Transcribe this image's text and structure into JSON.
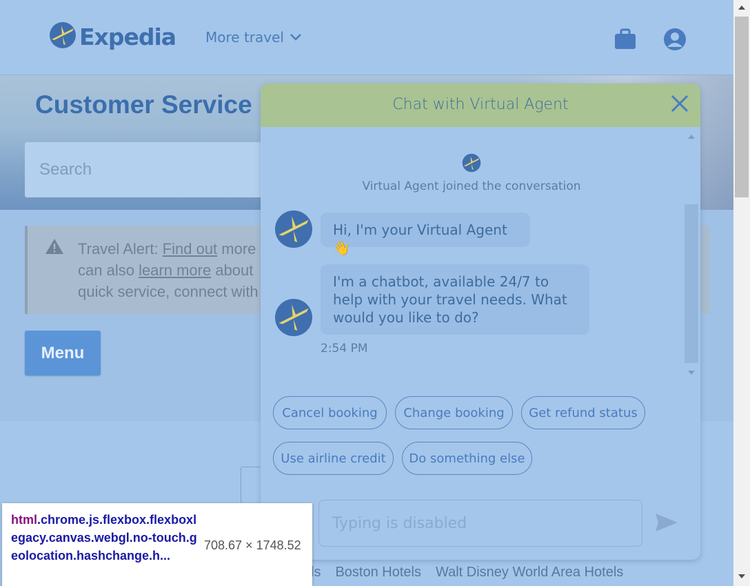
{
  "header": {
    "logo_text": "Expedia",
    "more_travel": "More travel",
    "icons": [
      "briefcase-icon",
      "account-icon"
    ]
  },
  "hero": {
    "title": "Customer Service",
    "search_placeholder": "Search"
  },
  "alert": {
    "prefix": "Travel Alert: ",
    "link1": "Find out",
    "line1_rest": " more",
    "line2_start": "can also ",
    "link2": "learn more",
    "line2_rest": " about",
    "line3": "quick service, connect with"
  },
  "menu_label": "Menu",
  "footer_links": [
    "ls",
    "Boston Hotels",
    "Walt Disney World Area Hotels"
  ],
  "chat": {
    "title": "Chat with Virtual Agent",
    "joined_text": "Virtual Agent joined the conversation",
    "messages": [
      "Hi, I'm your Virtual Agent 👋",
      "I'm a chatbot, available 24/7 to help with your travel needs. What would you like to do?"
    ],
    "time": "2:54 PM",
    "chips": [
      "Cancel booking",
      "Change booking",
      "Get refund status",
      "Use airline credit",
      "Do something else"
    ],
    "input_placeholder": "Typing is disabled"
  },
  "tooltip": {
    "tag": "html",
    "classes": ".chrome.js.flexbox.flexboxlegacy.canvas.webgl.no-touch.geolocation.hashchange.h...",
    "dimensions": "708.67 × 1748.52"
  },
  "colors": {
    "overlay_bg": "#a4c6ea",
    "brand_blue": "#3f6fae",
    "chat_header": "#a9c392",
    "logo_yellow": "#e3d36b"
  }
}
